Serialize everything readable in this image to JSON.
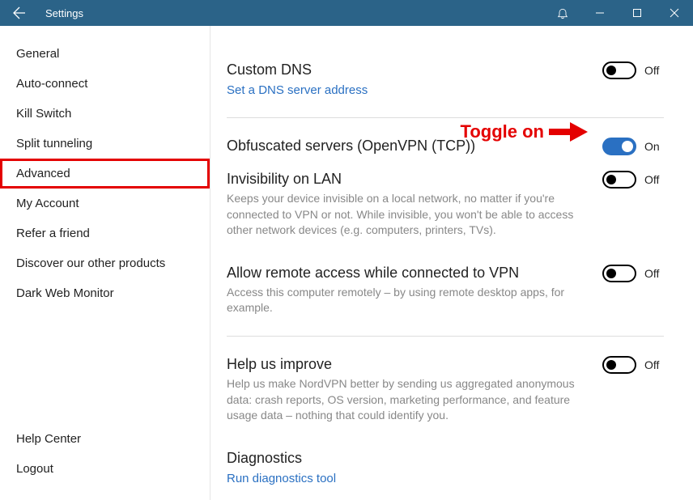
{
  "titlebar": {
    "title": "Settings"
  },
  "sidebar": {
    "items": [
      {
        "label": "General"
      },
      {
        "label": "Auto-connect"
      },
      {
        "label": "Kill Switch"
      },
      {
        "label": "Split tunneling"
      },
      {
        "label": "Advanced"
      },
      {
        "label": "My Account"
      },
      {
        "label": "Refer a friend"
      },
      {
        "label": "Discover our other products"
      },
      {
        "label": "Dark Web Monitor"
      }
    ],
    "footer": [
      {
        "label": "Help Center"
      },
      {
        "label": "Logout"
      }
    ]
  },
  "content": {
    "custom_dns": {
      "title": "Custom DNS",
      "link": "Set a DNS server address",
      "state": "Off"
    },
    "obfuscated": {
      "title": "Obfuscated servers (OpenVPN (TCP))",
      "state": "On"
    },
    "invisibility": {
      "title": "Invisibility on LAN",
      "desc": "Keeps your device invisible on a local network, no matter if you're connected to VPN or not. While invisible, you won't be able to access other network devices (e.g. computers, printers, TVs).",
      "state": "Off"
    },
    "remote_access": {
      "title": "Allow remote access while connected to VPN",
      "desc": "Access this computer remotely – by using remote desktop apps, for example.",
      "state": "Off"
    },
    "help_improve": {
      "title": "Help us improve",
      "desc": "Help us make NordVPN better by sending us aggregated anonymous data: crash reports, OS version, marketing performance, and feature usage data – nothing that could identify you.",
      "state": "Off"
    },
    "diagnostics": {
      "title": "Diagnostics",
      "link": "Run diagnostics tool"
    }
  },
  "annotation": {
    "label": "Toggle on"
  }
}
